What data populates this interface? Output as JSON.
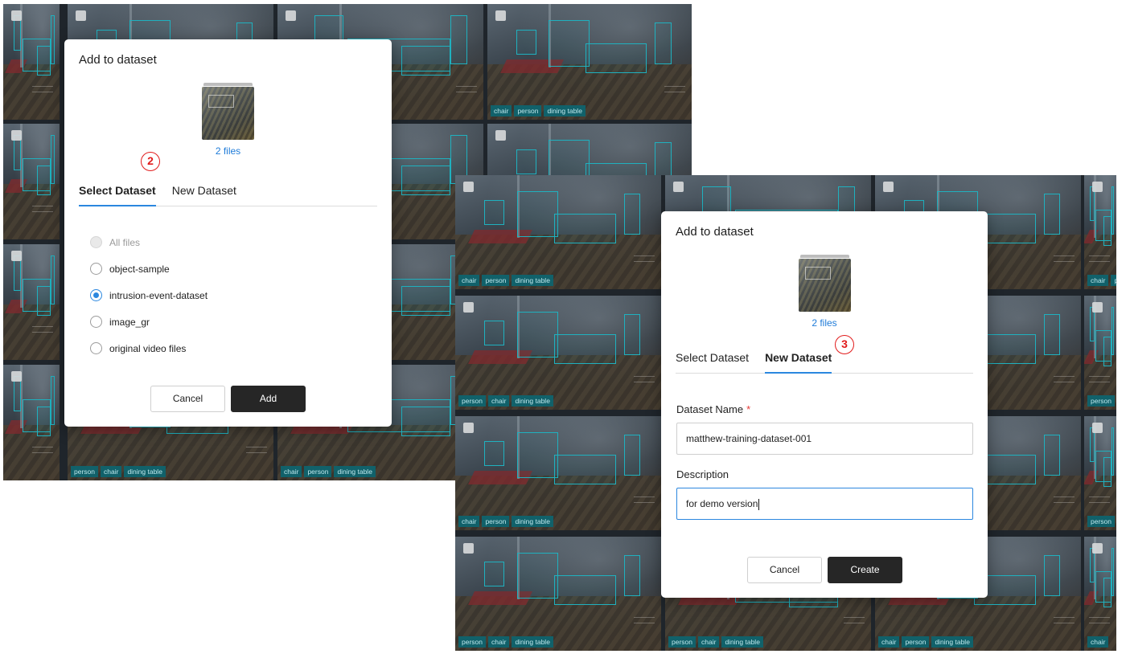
{
  "background_tile_tags": {
    "left": [
      {
        "tags": [
          "chair",
          "person",
          "dining table"
        ]
      },
      {
        "tags": [
          "person",
          "chair",
          "dining table"
        ]
      },
      {
        "tags": [
          "chair",
          "person",
          "dining table"
        ]
      }
    ],
    "right": [
      {
        "tags": [
          "chair",
          "person",
          "dining table"
        ]
      },
      {
        "tags": [
          "chair",
          "person"
        ]
      },
      {
        "tags": [
          "person",
          "chair",
          "dining table"
        ]
      },
      {
        "tags": [
          "person"
        ]
      },
      {
        "tags": [
          "chair",
          "person",
          "dining table"
        ]
      },
      {
        "tags": [
          "person"
        ]
      },
      {
        "tags": [
          "person",
          "chair",
          "dining table"
        ]
      },
      {
        "tags": [
          "person",
          "chair",
          "dining table"
        ]
      },
      {
        "tags": [
          "chair",
          "person",
          "dining table"
        ]
      },
      {
        "tags": [
          "chair"
        ]
      }
    ]
  },
  "dialog_select": {
    "title": "Add to dataset",
    "files_label": "2 files",
    "step_badge": "2",
    "tabs": [
      {
        "label": "Select Dataset",
        "active": true
      },
      {
        "label": "New Dataset",
        "active": false
      }
    ],
    "options": [
      {
        "label": "All files",
        "state": "disabled"
      },
      {
        "label": "object-sample",
        "state": "unchecked"
      },
      {
        "label": "intrusion-event-dataset",
        "state": "checked"
      },
      {
        "label": "image_gr",
        "state": "unchecked"
      },
      {
        "label": "original video files",
        "state": "unchecked"
      }
    ],
    "cancel_label": "Cancel",
    "add_label": "Add"
  },
  "dialog_new": {
    "title": "Add to dataset",
    "files_label": "2 files",
    "step_badge": "3",
    "tabs": [
      {
        "label": "Select Dataset",
        "active": false
      },
      {
        "label": "New Dataset",
        "active": true
      }
    ],
    "name_label": "Dataset Name",
    "required_mark": "*",
    "name_value": "matthew-training-dataset-001",
    "description_label": "Description",
    "description_value": "for demo version",
    "cancel_label": "Cancel",
    "create_label": "Create"
  },
  "colors": {
    "accent": "#2b87df",
    "badge": "#e11b1b",
    "detection_box": "#1fb1bf",
    "tag_bg": "#11616a",
    "primary_button": "#262626"
  }
}
